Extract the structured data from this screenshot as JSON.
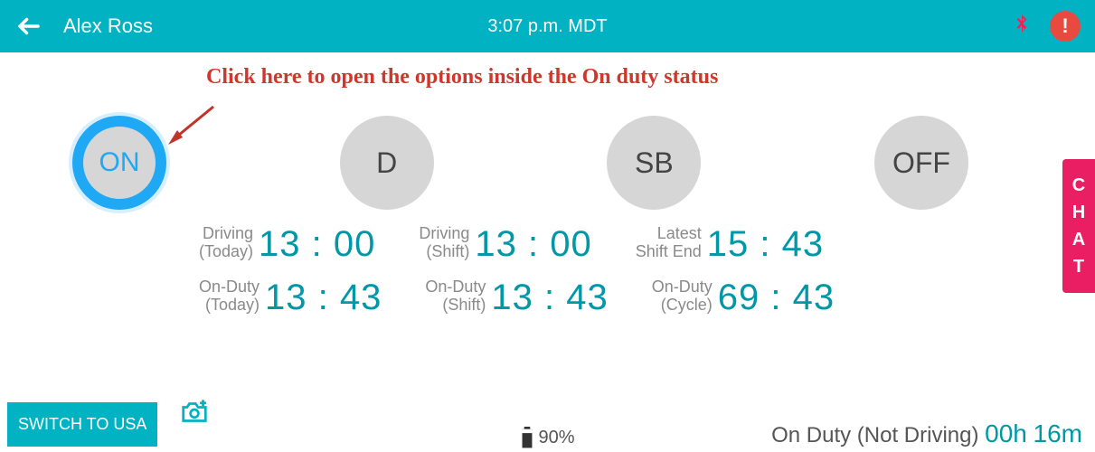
{
  "header": {
    "user_name": "Alex Ross",
    "time": "3:07 p.m. MDT",
    "alert_symbol": "!"
  },
  "annotation": {
    "text": "Click here to open the options inside the On duty status"
  },
  "status_buttons": {
    "on": "ON",
    "driving": "D",
    "sleeper": "SB",
    "off": "OFF"
  },
  "stats": {
    "row1": [
      {
        "label_top": "Driving",
        "label_bottom": "(Today)",
        "value": "13 : 00"
      },
      {
        "label_top": "Driving",
        "label_bottom": "(Shift)",
        "value": "13 : 00"
      },
      {
        "label_top": "Latest",
        "label_bottom": "Shift End",
        "value": "15 : 43"
      }
    ],
    "row2": [
      {
        "label_top": "On-Duty",
        "label_bottom": "(Today)",
        "value": "13 : 43"
      },
      {
        "label_top": "On-Duty",
        "label_bottom": "(Shift)",
        "value": "13 : 43"
      },
      {
        "label_top": "On-Duty",
        "label_bottom": "(Cycle)",
        "value": "69 : 43"
      }
    ]
  },
  "chat_tab": {
    "c": "C",
    "h": "H",
    "a": "A",
    "t": "T"
  },
  "footer": {
    "switch_label": "SWITCH TO USA",
    "battery_percent": "90%",
    "status_label": "On Duty (Not Driving) ",
    "status_hours": "00h",
    "status_minutes": "16m"
  }
}
